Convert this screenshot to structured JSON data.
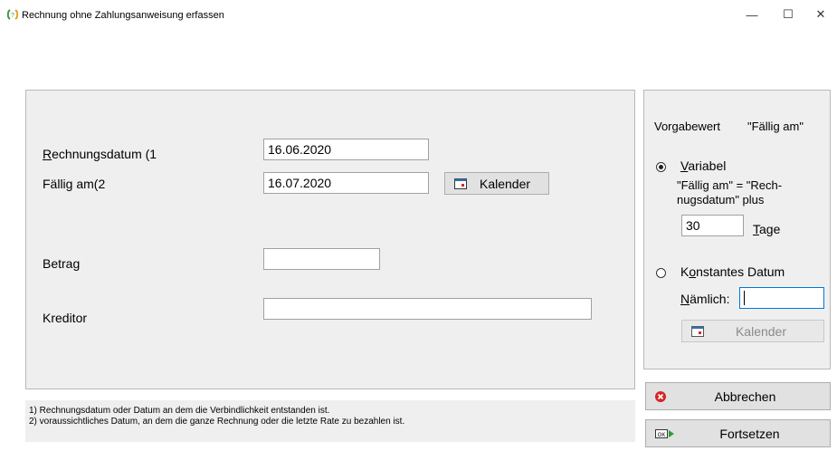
{
  "window": {
    "title": "Rechnung ohne Zahlungsanweisung erfassen",
    "controls": {
      "minimize": "—",
      "maximize": "☐",
      "close": "✕"
    }
  },
  "form": {
    "rechnungsdatum": {
      "label_u": "R",
      "label_rest": "echnungsdatum (1",
      "value": "16.06.2020"
    },
    "faellig": {
      "label": "Fällig am(2",
      "value": "16.07.2020"
    },
    "kalender_button": "Kalender",
    "betrag": {
      "label": "Betrag",
      "value": ""
    },
    "kreditor": {
      "label": "Kreditor",
      "value": ""
    }
  },
  "notes": {
    "line1": "1) Rechnungsdatum oder Datum an dem die Verbindlichkeit entstanden ist.",
    "line2": "2) voraussichtliches Datum, an dem die ganze Rechnung oder die letzte Rate zu bezahlen ist."
  },
  "vorgabe": {
    "label": "Vorgabewert",
    "value": "\"Fällig am\"",
    "variabel": {
      "label_u": "V",
      "label_rest": "ariabel",
      "selected": true,
      "desc_line1": "\"Fällig am\" = \"Rech-",
      "desc_line2": "nugsdatum\" plus",
      "days_value": "30",
      "days_label_u": "T",
      "days_label_rest": "age"
    },
    "konstant": {
      "label_pre": "K",
      "label_u": "o",
      "label_rest": "nstantes Datum",
      "selected": false,
      "naemlich_label_u": "N",
      "naemlich_label_rest": "ämlich:",
      "naemlich_value": "",
      "kalender_button": "Kalender"
    }
  },
  "actions": {
    "abbrechen": "Abbrechen",
    "fortsetzen": "Fortsetzen"
  },
  "colors": {
    "panel_bg": "#efefef",
    "button_bg": "#e1e1e1",
    "cancel_red": "#d62424",
    "ok_green": "#2e9d32"
  }
}
